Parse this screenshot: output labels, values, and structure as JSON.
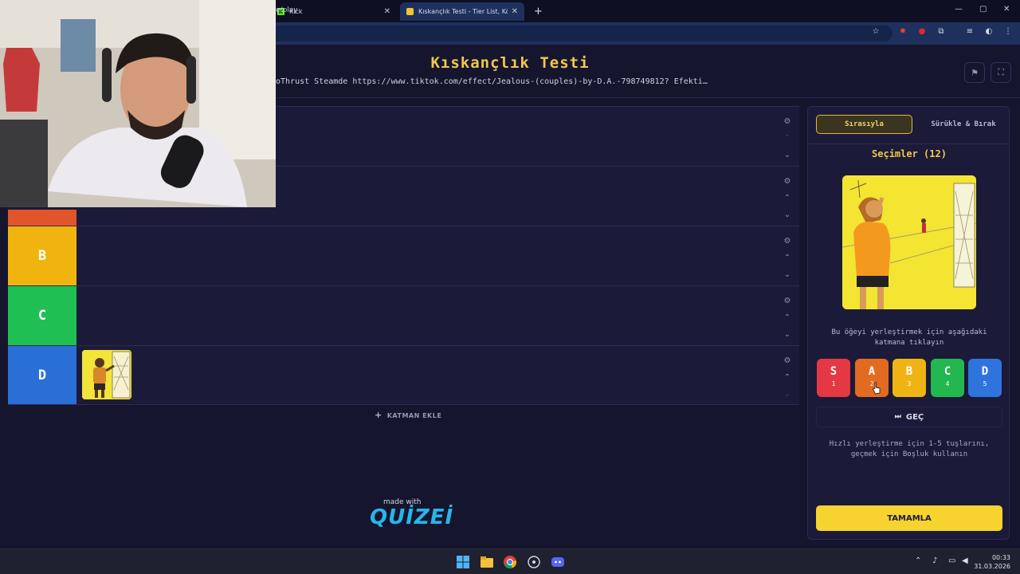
{
  "browser": {
    "tabs": [
      {
        "title": "Kick",
        "icon": "kick-icon"
      },
      {
        "title": "Kıskançlık Testi - Tier List, Kör S",
        "icon": "quizei-icon"
      }
    ],
    "new_tab": "+",
    "url": "e/play",
    "window_controls": [
      "—",
      "▢",
      "✕"
    ]
  },
  "page": {
    "title": "Kıskançlık Testi",
    "description": "oThrust Steamde https://www.tiktok.com/effect/Jealous-(couples)-by-D.A.-798749812? Efekti…"
  },
  "tiers": [
    {
      "label": "",
      "color": "#e0552a",
      "items": 0
    },
    {
      "label": "",
      "color": "#e0552a",
      "items": 0
    },
    {
      "label": "B",
      "color": "#f1b40f",
      "items": 0
    },
    {
      "label": "C",
      "color": "#1fbf54",
      "items": 0
    },
    {
      "label": "D",
      "color": "#2a6fd6",
      "items": 1
    }
  ],
  "add_tier_label": "KATMAN EKLE",
  "branding": {
    "made_with": "made with",
    "logo": "QUİZEİ"
  },
  "panel": {
    "mode_tabs": [
      "Sırasıyla",
      "Sürükle & Bırak"
    ],
    "choices_title": "Seçimler (12)",
    "instruction": "Bu öğeyi yerleştirmek için aşağıdaki katmana tıklayın",
    "picks": [
      {
        "letter": "S",
        "key": "1",
        "color": "#e43845"
      },
      {
        "letter": "A",
        "key": "2",
        "color": "#e36a21"
      },
      {
        "letter": "B",
        "key": "3",
        "color": "#efb414"
      },
      {
        "letter": "C",
        "key": "4",
        "color": "#23b74f"
      },
      {
        "letter": "D",
        "key": "5",
        "color": "#2f74dd"
      }
    ],
    "skip_label": "GEÇ",
    "hint": "Hızlı yerleştirme için 1-5 tuşlarını, geçmek için Boşluk kullanın",
    "finish_label": "TAMAMLA"
  },
  "taskbar": {
    "time": "00:33",
    "date": "31.03.2026"
  }
}
